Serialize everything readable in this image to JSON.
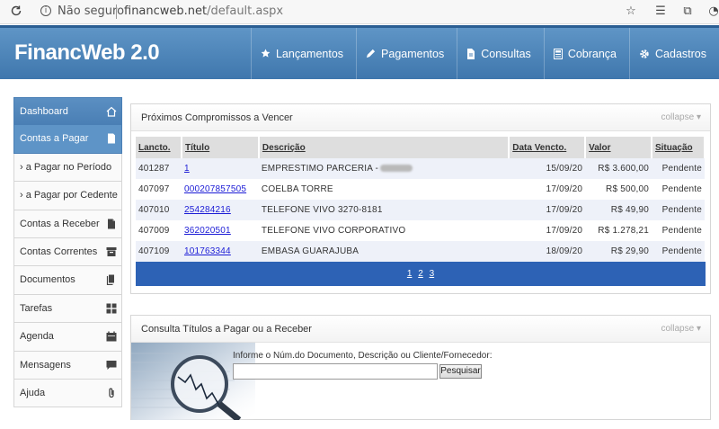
{
  "browser": {
    "security_label": "Não seguro",
    "url_host": "financweb.net",
    "url_path": "/default.aspx"
  },
  "header": {
    "brand": "FinancWeb 2.0",
    "nav": [
      {
        "label": "Lançamentos",
        "icon": "star-icon"
      },
      {
        "label": "Pagamentos",
        "icon": "pencil-icon"
      },
      {
        "label": "Consultas",
        "icon": "document-icon"
      },
      {
        "label": "Cobrança",
        "icon": "calculator-icon"
      },
      {
        "label": "Cadastros",
        "icon": "gear-icon"
      }
    ]
  },
  "sidebar": {
    "items": [
      {
        "label": "Dashboard",
        "icon": "home-icon"
      },
      {
        "label": "Contas a Pagar",
        "icon": "file-icon"
      },
      {
        "label": "› a Pagar no Período"
      },
      {
        "label": "› a Pagar por Cedente"
      },
      {
        "label": "Contas a Receber",
        "icon": "file-icon"
      },
      {
        "label": "Contas Correntes",
        "icon": "archive-icon"
      },
      {
        "label": "Documentos",
        "icon": "documents-icon"
      },
      {
        "label": "Tarefas",
        "icon": "grid-icon"
      },
      {
        "label": "Agenda",
        "icon": "calendar-icon"
      },
      {
        "label": "Mensagens",
        "icon": "chat-icon"
      },
      {
        "label": "Ajuda",
        "icon": "paperclip-icon"
      }
    ]
  },
  "commitments": {
    "title": "Próximos Compromissos a Vencer",
    "collapse_label": "collapse",
    "columns": [
      "Lancto.",
      "Título",
      "Descrição",
      "Data Vencto.",
      "Valor",
      "Situação"
    ],
    "rows": [
      {
        "lancto": "401287",
        "titulo": "1",
        "descricao": "EMPRESTIMO PARCERIA -",
        "data": "15/09/20",
        "valor": "R$ 3.600,00",
        "situacao": "Pendente"
      },
      {
        "lancto": "407097",
        "titulo": "000207857505",
        "descricao": "COELBA TORRE",
        "data": "17/09/20",
        "valor": "R$ 500,00",
        "situacao": "Pendente"
      },
      {
        "lancto": "407010",
        "titulo": "254284216",
        "descricao": "TELEFONE VIVO 3270-8181",
        "data": "17/09/20",
        "valor": "R$ 49,90",
        "situacao": "Pendente"
      },
      {
        "lancto": "407009",
        "titulo": "362020501",
        "descricao": "TELEFONE VIVO CORPORATIVO",
        "data": "17/09/20",
        "valor": "R$ 1.278,21",
        "situacao": "Pendente"
      },
      {
        "lancto": "407109",
        "titulo": "101763344",
        "descricao": "EMBASA GUARAJUBA",
        "data": "18/09/20",
        "valor": "R$ 29,90",
        "situacao": "Pendente"
      }
    ],
    "pages": [
      "1",
      "2",
      "3"
    ]
  },
  "search": {
    "title": "Consulta Títulos a Pagar ou a Receber",
    "collapse_label": "collapse",
    "label": "Informe o Núm.do Documento, Descrição ou Cliente/Fornecedor:",
    "value": "",
    "button_label": "Pesquisar"
  }
}
